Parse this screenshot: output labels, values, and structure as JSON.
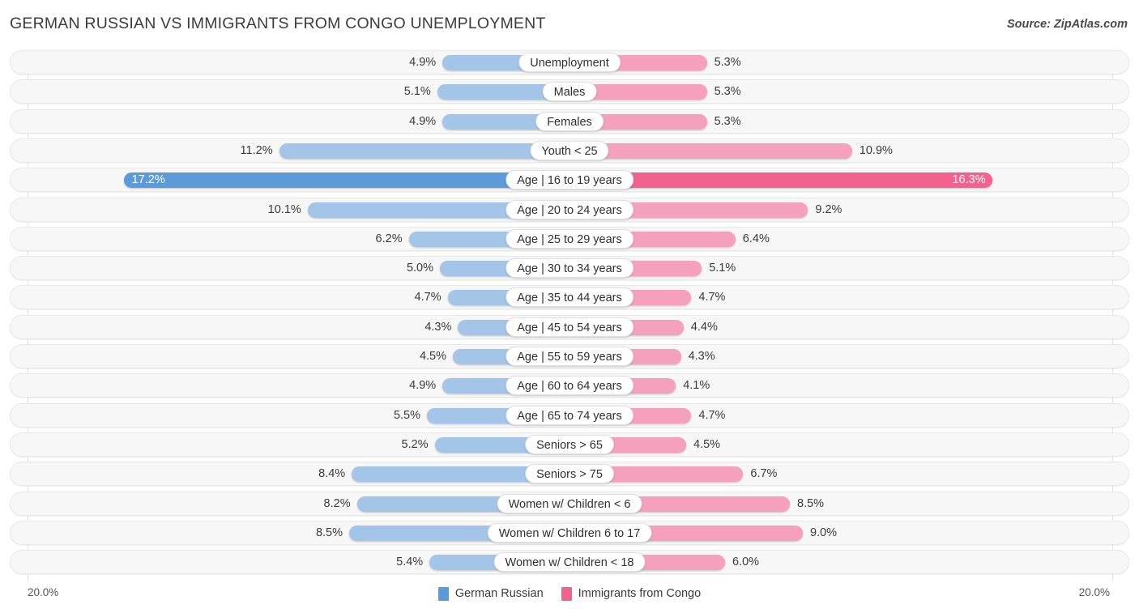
{
  "header": {
    "title": "GERMAN RUSSIAN VS IMMIGRANTS FROM CONGO UNEMPLOYMENT",
    "source": "Source: ZipAtlas.com"
  },
  "legend": {
    "items": [
      {
        "label": "German Russian",
        "color": "#5b9bd9"
      },
      {
        "label": "Immigrants from Congo",
        "color": "#f2628f"
      }
    ]
  },
  "axis": {
    "left_label": "20.0%",
    "right_label": "20.0%",
    "max": 20.0
  },
  "colors": {
    "left_normal": "#a3c6e8",
    "left_highlight": "#5b9bd9",
    "right_normal": "#f5a0bd",
    "right_highlight": "#f2628f",
    "track": "#f7f7f7",
    "track_border": "#e8e8e8"
  },
  "chart_data": {
    "type": "bar",
    "title": "GERMAN RUSSIAN VS IMMIGRANTS FROM CONGO UNEMPLOYMENT",
    "subtitle": "Source: ZipAtlas.com",
    "orientation": "horizontal-diverging",
    "xlabel": "",
    "ylabel": "",
    "xlim": [
      20.0,
      20.0
    ],
    "grid": true,
    "legend_position": "bottom-center",
    "categories": [
      "Unemployment",
      "Males",
      "Females",
      "Youth < 25",
      "Age | 16 to 19 years",
      "Age | 20 to 24 years",
      "Age | 25 to 29 years",
      "Age | 30 to 34 years",
      "Age | 35 to 44 years",
      "Age | 45 to 54 years",
      "Age | 55 to 59 years",
      "Age | 60 to 64 years",
      "Age | 65 to 74 years",
      "Seniors > 65",
      "Seniors > 75",
      "Women w/ Children < 6",
      "Women w/ Children 6 to 17",
      "Women w/ Children < 18"
    ],
    "series": [
      {
        "name": "German Russian",
        "values": [
          4.9,
          5.1,
          4.9,
          11.2,
          17.2,
          10.1,
          6.2,
          5.0,
          4.7,
          4.3,
          4.5,
          4.9,
          5.5,
          5.2,
          8.4,
          8.2,
          8.5,
          5.4
        ],
        "labels": [
          "4.9%",
          "5.1%",
          "4.9%",
          "11.2%",
          "17.2%",
          "10.1%",
          "6.2%",
          "5.0%",
          "4.7%",
          "4.3%",
          "4.5%",
          "4.9%",
          "5.5%",
          "5.2%",
          "8.4%",
          "8.2%",
          "8.5%",
          "5.4%"
        ]
      },
      {
        "name": "Immigrants from Congo",
        "values": [
          5.3,
          5.3,
          5.3,
          10.9,
          16.3,
          9.2,
          6.4,
          5.1,
          4.7,
          4.4,
          4.3,
          4.1,
          4.7,
          4.5,
          6.7,
          8.5,
          9.0,
          6.0
        ],
        "labels": [
          "5.3%",
          "5.3%",
          "5.3%",
          "10.9%",
          "16.3%",
          "9.2%",
          "6.4%",
          "5.1%",
          "4.7%",
          "4.4%",
          "4.3%",
          "4.1%",
          "4.7%",
          "4.5%",
          "6.7%",
          "8.5%",
          "9.0%",
          "6.0%"
        ]
      }
    ],
    "highlighted_index": 4
  }
}
